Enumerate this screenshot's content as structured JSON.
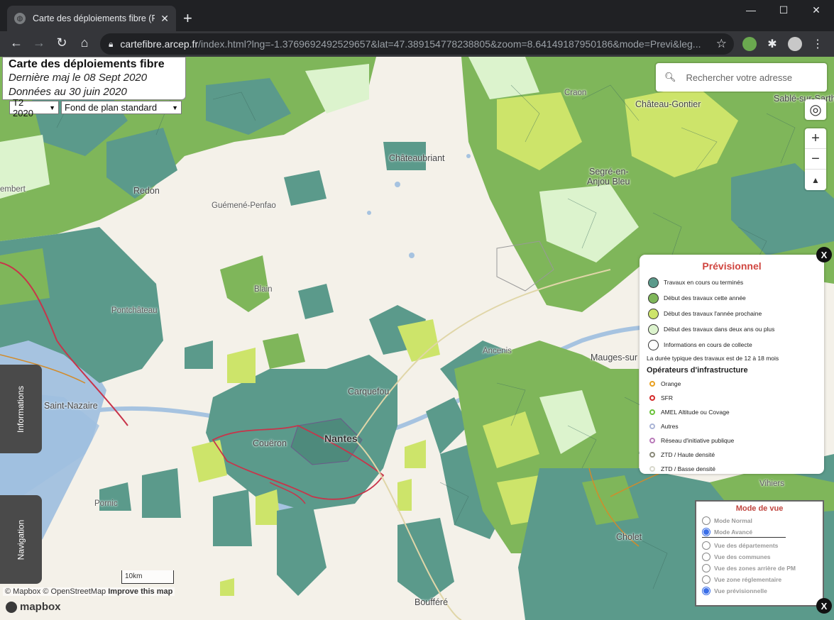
{
  "browser": {
    "tab_title": "Carte des déploiements fibre (Ftt",
    "url_host": "cartefibre.arcep.fr",
    "url_path": "/index.html?lng=-1.3769692492529657&lat=47.389154778238805&zoom=8.64149187950186&mode=Previ&leg..."
  },
  "header": {
    "title": "Carte des déploiements fibre",
    "update_line": "Dernière maj le 08 Sept 2020",
    "data_line": "Données au 30 juin 2020"
  },
  "selects": {
    "period": "T2 2020",
    "basemap": "Fond de plan standard"
  },
  "search": {
    "placeholder": "Rechercher votre adresse"
  },
  "places": {
    "craon": "Craon",
    "sable": "Sablé-sur-Sarthe",
    "chateau_gontier": "Château-Gontier",
    "chateaubriant": "Châteaubriant",
    "segre_line1": "Segré-en-",
    "segre_line2": "Anjou Bleu",
    "redon": "Redon",
    "guemene": "Guémené-Penfao",
    "embert": "embert",
    "blain": "Blain",
    "pontchateau": "Pontchâteau",
    "ancenis": "Ancenis",
    "mauges": "Mauges-sur",
    "carquefou": "Carquefou",
    "saint_nazaire": "Saint-Nazaire",
    "coueron": "Couëron",
    "nantes": "Nantes",
    "pornic": "Pornic",
    "vihiers": "Vihiers",
    "cholet": "Cholet",
    "bouffere": "Boufféré"
  },
  "legend": {
    "title": "Prévisionnel",
    "items": [
      {
        "label": "Travaux en cours ou terminés",
        "color": "#5b9a8b"
      },
      {
        "label": "Début des travaux cette année",
        "color": "#7fb65a"
      },
      {
        "label": "Début des travaux l'année prochaine",
        "color": "#cde46a"
      },
      {
        "label": "Début des travaux dans deux ans ou plus",
        "color": "#dcf3cd"
      },
      {
        "label": "Informations en cours de collecte",
        "color": "#ffffff"
      }
    ],
    "note": "La durée typique des travaux est de 12 à 18 mois",
    "operators_title": "Opérateurs d'infrastructure",
    "operators": [
      {
        "label": "Orange",
        "color": "#e8a020"
      },
      {
        "label": "SFR",
        "color": "#d42a2a"
      },
      {
        "label": "AMEL Altitude ou Covage",
        "color": "#6ac23a"
      },
      {
        "label": "Autres",
        "color": "#aab4d6"
      },
      {
        "label": "Réseau d'initiative publique",
        "color": "#b97ab9"
      },
      {
        "label": "ZTD / Haute densité",
        "color": "#8a8a7a"
      },
      {
        "label": "ZTD / Basse densité",
        "color": "#d8d8cc"
      }
    ]
  },
  "mode_box": {
    "title": "Mode de vue",
    "modes": [
      {
        "label": "Mode Normal",
        "checked": false
      },
      {
        "label": "Mode Avancé",
        "checked": true
      }
    ],
    "views": [
      {
        "label": "Vue des départements",
        "checked": false
      },
      {
        "label": "Vue des communes",
        "checked": false
      },
      {
        "label": "Vue des zones arrière de PM",
        "checked": false
      },
      {
        "label": "Vue zone réglementaire",
        "checked": false
      },
      {
        "label": "Vue prévisionnelle",
        "checked": true
      }
    ]
  },
  "side_tabs": {
    "informations": "Informations",
    "navigation": "Navigation"
  },
  "scale": "10km",
  "attribution": {
    "mapbox": "© Mapbox",
    "osm": "© OpenStreetMap",
    "improve": "Improve this map"
  },
  "logo": "mapbox",
  "close_label": "X"
}
